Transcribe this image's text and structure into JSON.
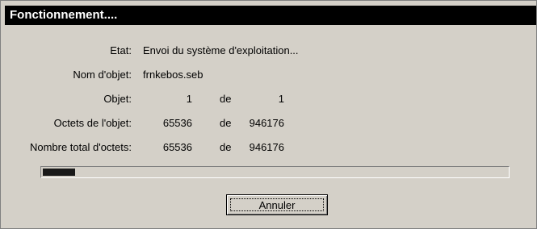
{
  "dialog": {
    "title": "Fonctionnement....",
    "rows": {
      "etat": {
        "label": "Etat:",
        "value": "Envoi du système d'exploitation..."
      },
      "nom_objet": {
        "label": "Nom d'objet:",
        "value": "frnkebos.seb"
      },
      "objet": {
        "label": "Objet:",
        "current": "1",
        "de": "de",
        "total": "1"
      },
      "octets_objet": {
        "label": "Octets de l'objet:",
        "current": "65536",
        "de": "de",
        "total": "946176"
      },
      "total_octets": {
        "label": "Nombre total d'octets:",
        "current": "65536",
        "de": "de",
        "total": "946176"
      }
    },
    "progress": {
      "percent": 6.9
    },
    "cancel_label": "Annuler"
  }
}
